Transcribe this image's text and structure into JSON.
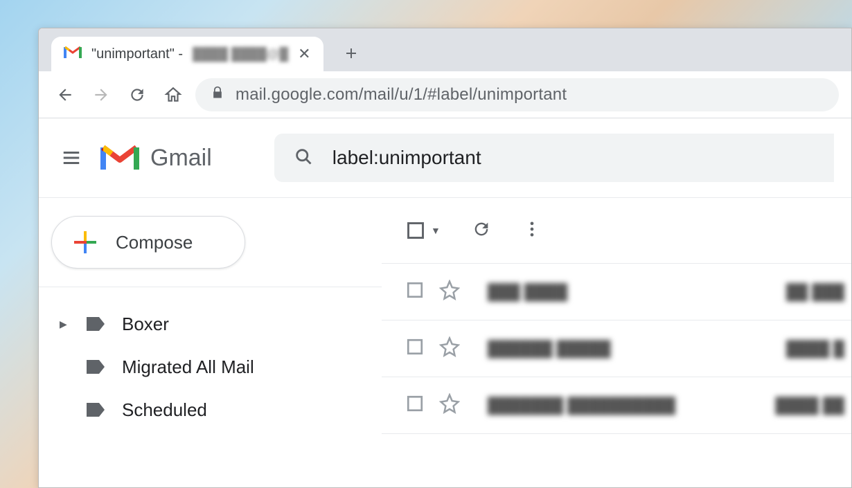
{
  "browser": {
    "tab_title": "\"unimportant\" -",
    "tab_account_blur": "████ ████@█",
    "url": "mail.google.com/mail/u/1/#label/unimportant"
  },
  "gmail": {
    "product_name": "Gmail",
    "search_query": "label:unimportant",
    "compose_label": "Compose",
    "labels": [
      {
        "name": "Boxer",
        "expandable": true
      },
      {
        "name": "Migrated All Mail",
        "expandable": false
      },
      {
        "name": "Scheduled",
        "expandable": false
      }
    ],
    "rows": [
      {
        "sender": "███ ████",
        "subject": "██ ███"
      },
      {
        "sender": "██████ █████",
        "subject": "████ █"
      },
      {
        "sender": "███████ ██████████",
        "subject": "████ ██"
      }
    ]
  }
}
